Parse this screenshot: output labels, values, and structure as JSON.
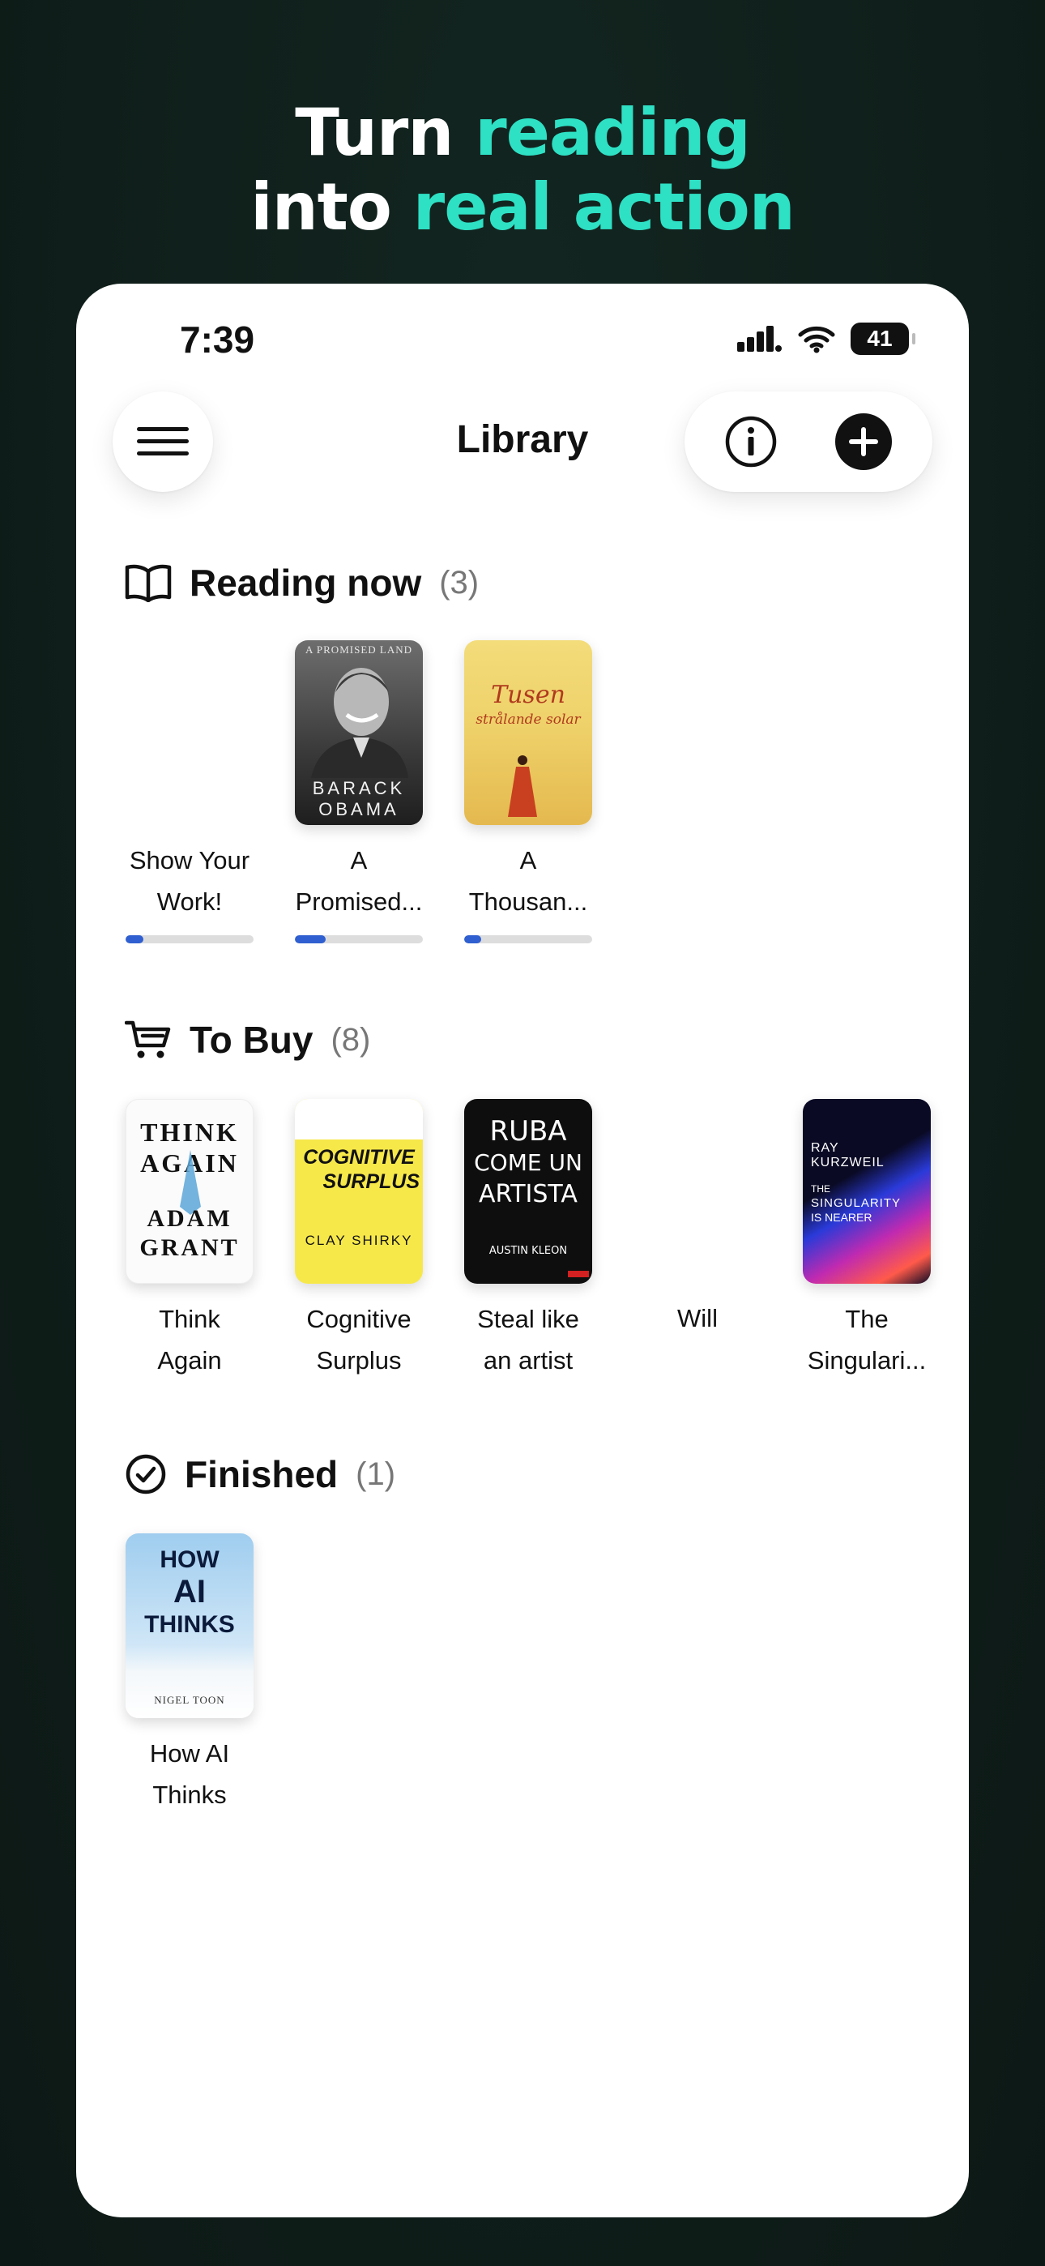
{
  "hero": {
    "line1_plain": "Turn ",
    "line1_accent": "reading",
    "line2_plain": "into ",
    "line2_accent": "real action"
  },
  "status": {
    "time": "7:39",
    "battery": "41"
  },
  "nav": {
    "title": "Library",
    "menu_icon": "hamburger-icon",
    "info_icon": "info-icon",
    "add_icon": "plus-circle-icon"
  },
  "colors": {
    "accent": "#2ee0c4",
    "progress": "#2f5fd0",
    "background": "#0f1e1a"
  },
  "reading_now": {
    "title": "Reading now",
    "count": "(3)",
    "icon": "book-open-icon",
    "books": [
      {
        "title": "Show Your Work!",
        "line1": "Show Your",
        "line2": "Work!",
        "progress": 0.14,
        "has_cover": false
      },
      {
        "title": "A Promised...",
        "line1": "A",
        "line2": "Promised...",
        "progress": 0.24,
        "has_cover": true,
        "cover": {
          "top_text": "A PROMISED LAND",
          "name1": "BARACK",
          "name2": "OBAMA"
        }
      },
      {
        "title": "A Thousan...",
        "line1": "A",
        "line2": "Thousan...",
        "progress": 0.13,
        "has_cover": true,
        "cover": {
          "title1": "Tusen",
          "title2": "strålande solar"
        }
      }
    ]
  },
  "to_buy": {
    "title": "To Buy",
    "count": "(8)",
    "icon": "cart-icon",
    "books": [
      {
        "line1": "Think",
        "line2": "Again",
        "cover": {
          "l1": "THINK",
          "l2": "AGAIN",
          "l3": "ADAM",
          "l4": "GRANT"
        }
      },
      {
        "line1": "Cognitive",
        "line2": "Surplus",
        "cover": {
          "l1": "COGNITIVE",
          "l2": "SURPLUS",
          "author": "CLAY SHIRKY"
        }
      },
      {
        "line1": "Steal like",
        "line2": "an artist",
        "cover": {
          "l1": "RUBA",
          "l2": "COME UN",
          "l3": "ARTISTA",
          "author": "AUSTIN KLEON"
        }
      },
      {
        "line1": "Will",
        "line2": ""
      },
      {
        "line1": "The",
        "line2": "Singulari...",
        "cover": {
          "author1": "RAY",
          "author2": "KURZWEIL",
          "t1": "THE",
          "t2": "SINGULARITY",
          "t3": "IS NEARER"
        }
      }
    ]
  },
  "finished": {
    "title": "Finished",
    "count": "(1)",
    "icon": "check-circle-icon",
    "books": [
      {
        "line1": "How AI",
        "line2": "Thinks",
        "cover": {
          "l1": "HOW",
          "l2": "AI",
          "l3": "THINKS",
          "author": "NIGEL TOON"
        }
      }
    ]
  }
}
